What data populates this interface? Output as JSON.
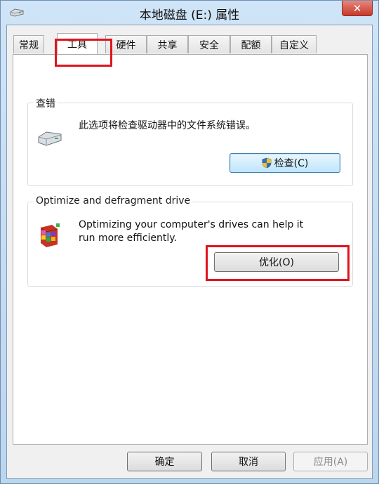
{
  "window": {
    "title": "本地磁盘 (E:) 属性",
    "close": "✕"
  },
  "tabs": [
    {
      "label": "常规"
    },
    {
      "label": "工具"
    },
    {
      "label": "硬件"
    },
    {
      "label": "共享"
    },
    {
      "label": "安全"
    },
    {
      "label": "配额"
    },
    {
      "label": "自定义"
    }
  ],
  "error_check": {
    "title": "查错",
    "description": "此选项将检查驱动器中的文件系统错误。",
    "button_label": "检查(C)"
  },
  "optimize": {
    "title": "Optimize and defragment drive",
    "description_line1": "Optimizing your computer's drives can help it",
    "description_line2": "run more efficiently.",
    "button_label": "优化(O)"
  },
  "footer": {
    "ok": "确定",
    "cancel": "取消",
    "apply": "应用(A)"
  }
}
